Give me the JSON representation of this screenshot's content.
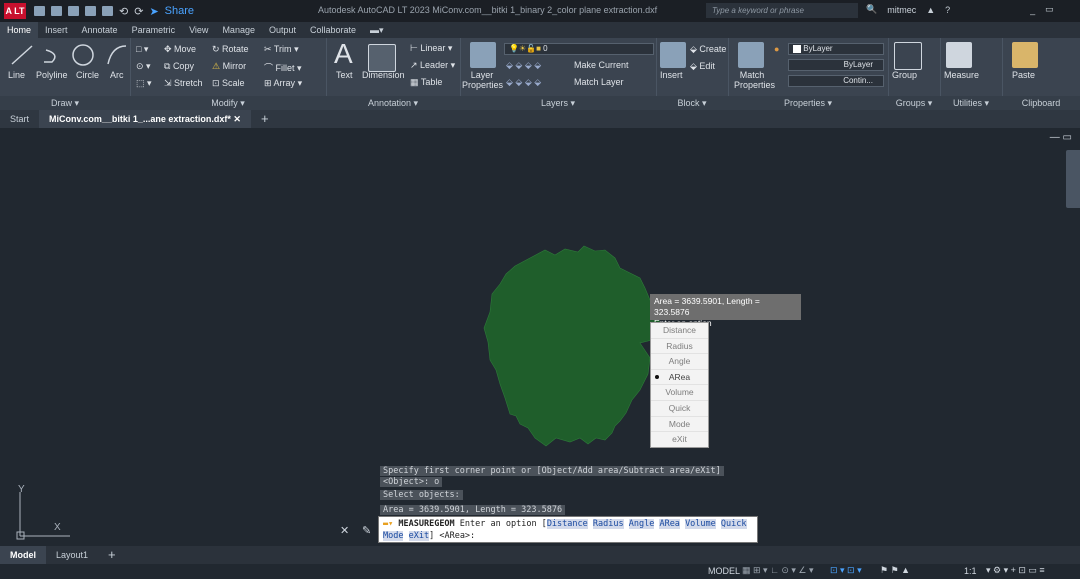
{
  "titlebar": {
    "logo": "A LT",
    "share": "Share",
    "title": "Autodesk AutoCAD LT 2023   MiConv.com__bitki 1_binary 2_color plane extraction.dxf",
    "search_placeholder": "Type a keyword or phrase",
    "user": "mitmec"
  },
  "menu_tabs": [
    "Home",
    "Insert",
    "Annotate",
    "Parametric",
    "View",
    "Manage",
    "Output",
    "Collaborate"
  ],
  "ribbon": {
    "draw": {
      "title": "Draw ▾",
      "line": "Line",
      "polyline": "Polyline",
      "circle": "Circle",
      "arc": "Arc"
    },
    "modify": {
      "title": "Modify ▾",
      "move": "Move",
      "rotate": "Rotate",
      "trim": "Trim",
      "copy": "Copy",
      "mirror": "Mirror",
      "fillet": "Fillet",
      "stretch": "Stretch",
      "scale": "Scale",
      "array": "Array"
    },
    "annotation": {
      "title": "Annotation ▾",
      "text": "Text",
      "dimension": "Dimension",
      "linear": "Linear",
      "leader": "Leader",
      "table": "Table"
    },
    "layers": {
      "title": "Layers ▾",
      "layer_properties": "Layer Properties",
      "layer_value": "0",
      "make_current": "Make Current",
      "match_layer": "Match Layer"
    },
    "block": {
      "title": "Block ▾",
      "insert": "Insert",
      "create": "Create",
      "edit": "Edit"
    },
    "properties": {
      "title": "Properties ▾",
      "match_properties": "Match Properties",
      "color": "ByLayer",
      "linetype": "ByLayer",
      "lineweight": "Contin..."
    },
    "groups": {
      "title": "Groups ▾",
      "group": "Group"
    },
    "utilities": {
      "title": "Utilities ▾",
      "measure": "Measure"
    },
    "clipboard": {
      "title": "Clipboard",
      "paste": "Paste"
    }
  },
  "doc_tabs": {
    "start": "Start",
    "active": "MiConv.com__bitki 1_...ane extraction.dxf*"
  },
  "tooltip": {
    "line1": "Area = 3639.5901, Length = 323.5876",
    "line2": "Enter an option"
  },
  "option_menu": {
    "items": [
      "Distance",
      "Radius",
      "Angle",
      "ARea",
      "Volume",
      "Quick",
      "Mode",
      "eXit"
    ],
    "selected": "ARea"
  },
  "command_history": [
    "Specify first corner point or [Object/Add area/Subtract area/eXit]",
    "<Object>: o",
    "Select objects:",
    "Area = 3639.5901, Length = 323.5876"
  ],
  "command_line": {
    "cmd": "MEASUREGEOM",
    "prompt": "Enter an option",
    "opts1": [
      "Distance",
      "Radius",
      "Angle",
      "ARea",
      "Volume",
      "Quick"
    ],
    "opts2": [
      "Mode",
      "eXit"
    ],
    "default": "<ARea>:"
  },
  "layout_tabs": [
    "Model",
    "Layout1"
  ],
  "status": {
    "mode": "MODEL",
    "scale": "1:1"
  },
  "colors": {
    "shape_fill": "#1f5e2b",
    "canvas_bg": "#212830",
    "ribbon_bg": "#3b4450"
  }
}
